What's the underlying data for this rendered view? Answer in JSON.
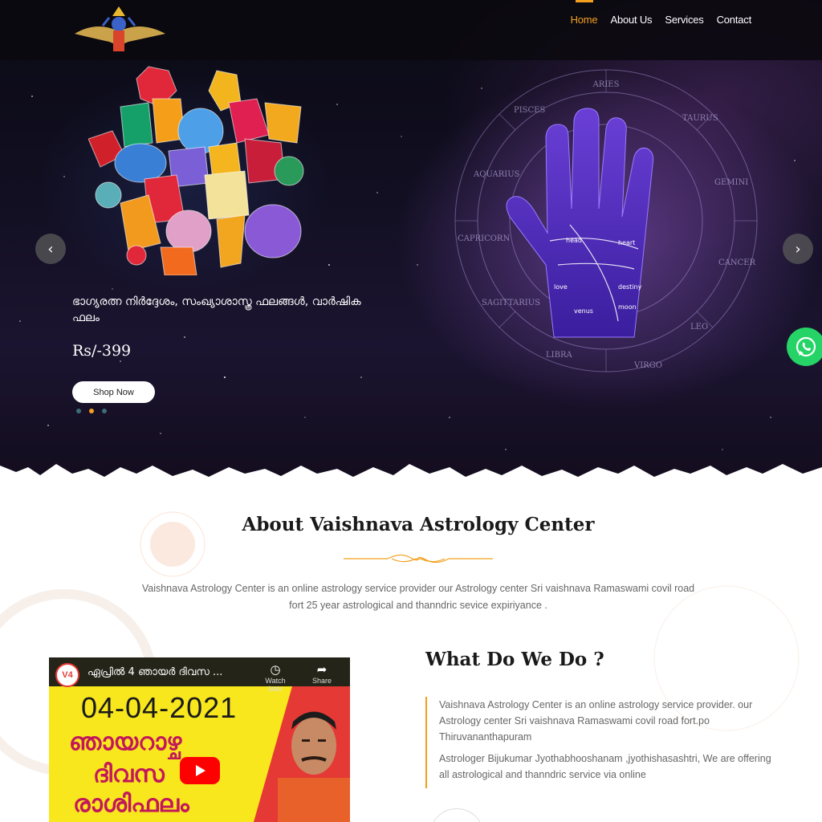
{
  "nav": {
    "items": [
      {
        "label": "Home",
        "active": true
      },
      {
        "label": "About Us"
      },
      {
        "label": "Services"
      },
      {
        "label": "Contact"
      }
    ]
  },
  "hero": {
    "slide_text": "ഭാഗ്യരത്ന നിർദ്ദേശം, സംഖ്യാശാസ്ത്ര ഫലങ്ങൾ, വാർഷിക ഫലം",
    "price": "Rs/-399",
    "button_label": "Shop Now",
    "prev_icon": "chevron-left-icon",
    "next_icon": "chevron-right-icon",
    "slides": 3,
    "active_slide": 2
  },
  "about": {
    "title": "About Vaishnava Astrology Center",
    "text": "Vaishnava Astrology Center is an online astrology service provider our Astrology center Sri vaishnava Ramaswami covil road fort 25 year astrological and thanndric sevice expiriyance ."
  },
  "video": {
    "channel_logo": "V4",
    "title": "ഏപ്രിൽ 4 ഞായർ ദിവസ ...",
    "watch_later": "Watch later",
    "share": "Share",
    "date": "04-04-2021",
    "line1": "ഞായറാഴ്ച",
    "line2": "ദിവസ",
    "line3": "രാശിഫലം"
  },
  "what": {
    "title": "What Do We Do ?",
    "para1": "Vaishnava Astrology Center is an online astrology service provider. our Astrology center Sri vaishnava Ramaswami covil road fort.po Thiruvananthapuram",
    "para2": "Astrologer Bijukumar Jyothabhooshanam ,jyothishasashtri, We are offering all astrological and thanndric service via online"
  },
  "colors": {
    "accent": "#f2a01e",
    "whatsapp": "#25d366",
    "youtube": "#ff0000"
  }
}
